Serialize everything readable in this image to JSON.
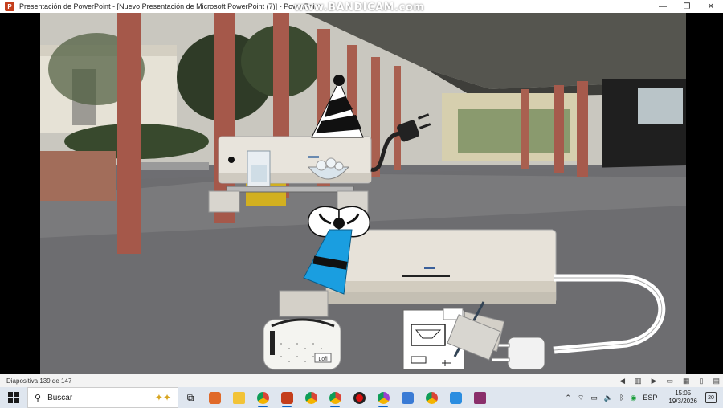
{
  "window": {
    "title": "Presentación de PowerPoint - [Nuevo Presentación de Microsoft PowerPoint (7)] - PowerPoint",
    "app_badge": "P",
    "minimize": "—",
    "maximize": "❐",
    "close": "✕"
  },
  "watermark": "www.BANDICAM.com",
  "slide": {
    "lunch_bag_label": "Lofi"
  },
  "statusbar": {
    "slide_counter": "Diapositiva 139 de 147"
  },
  "taskbar": {
    "search_label": "Buscar",
    "language": "ESP",
    "time": "15:05",
    "date": "19/3/2026",
    "notifications": "20"
  },
  "colors": {
    "ppt_accent": "#c43e1c",
    "taskbar_bg": "#dfe6ef",
    "party_hat_blue": "#1a9ee0"
  }
}
